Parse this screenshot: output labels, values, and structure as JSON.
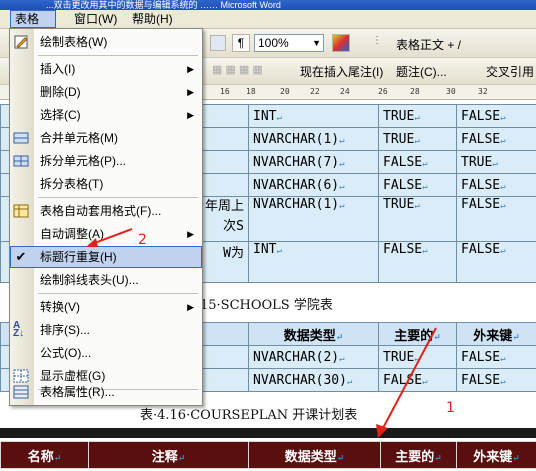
{
  "window": {
    "title": "...双击更改用其中的数据与编辑系统的 …… Microsoft Word"
  },
  "menubar": {
    "items": [
      "表格(A)",
      "窗口(W)",
      "帮助(H)"
    ]
  },
  "toolbar": {
    "zoom": "100%",
    "style": "表格正文 + /",
    "insert_endnote": "现在插入尾注(I)",
    "footnote": "题注(C)...",
    "cross_ref": "交叉引用"
  },
  "ruler": {
    "ticks": [
      "16",
      "18",
      "20",
      "22",
      "24",
      "26",
      "28",
      "30",
      "32"
    ]
  },
  "top_table": {
    "rows": [
      {
        "c1": "",
        "type": "INT",
        "pk": "TRUE",
        "fk": "FALSE"
      },
      {
        "c1": "",
        "type": "NVARCHAR(1)",
        "pk": "TRUE",
        "fk": "FALSE"
      },
      {
        "c1": "",
        "type": "NVARCHAR(7)",
        "pk": "FALSE",
        "fk": "TRUE"
      },
      {
        "c1": "",
        "type": "NVARCHAR(6)",
        "pk": "FALSE",
        "fk": "FALSE"
      },
      {
        "c1": "年周上",
        "c1b": "次S",
        "type": "NVARCHAR(1)",
        "pk": "TRUE",
        "fk": "FALSE"
      },
      {
        "c1": "W为",
        "type": "INT",
        "pk": "FALSE",
        "fk": "FALSE"
      }
    ]
  },
  "captions": {
    "schools": "15·SCHOOLS 学院表",
    "courseplan": "表·4.16·COURSEPLAN 开课计划表"
  },
  "schools_table": {
    "headers": [
      "数据类型",
      "主要的",
      "外来键"
    ],
    "rows": [
      {
        "type": "NVARCHAR(2)",
        "pk": "TRUE",
        "fk": "FALSE"
      },
      {
        "type": "NVARCHAR(30)",
        "pk": "FALSE",
        "fk": "FALSE"
      }
    ]
  },
  "course_table": {
    "headers": [
      "名称",
      "注释",
      "数据类型",
      "主要的",
      "外来键"
    ]
  },
  "menu": {
    "items": [
      {
        "label": "绘制表格(W)"
      },
      {
        "label": "插入(I)"
      },
      {
        "label": "删除(D)"
      },
      {
        "label": "选择(C)"
      },
      {
        "label": "合并单元格(M)"
      },
      {
        "label": "拆分单元格(P)..."
      },
      {
        "label": "拆分表格(T)"
      },
      {
        "label": "表格自动套用格式(F)..."
      },
      {
        "label": "自动调整(A)"
      },
      {
        "label": "标题行重复(H)"
      },
      {
        "label": "绘制斜线表头(U)..."
      },
      {
        "label": "转换(V)"
      },
      {
        "label": "排序(S)..."
      },
      {
        "label": "公式(O)..."
      },
      {
        "label": "显示虚框(G)"
      },
      {
        "label": "表格属性(R)..."
      }
    ]
  },
  "annotations": {
    "a1": "1",
    "a2": "2"
  },
  "colors": {
    "menu_highlight": "#c1d2ee",
    "annotation": "#e0221a",
    "dark_header": "#5a0f0f"
  }
}
